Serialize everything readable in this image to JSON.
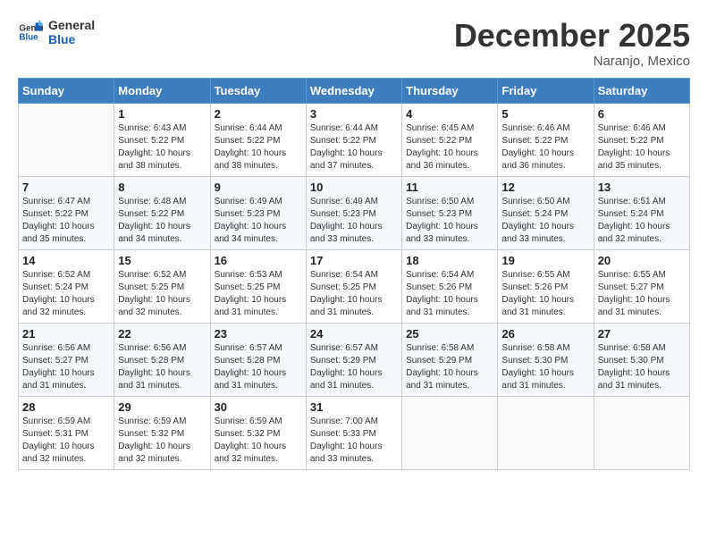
{
  "header": {
    "logo_line1": "General",
    "logo_line2": "Blue",
    "month_year": "December 2025",
    "location": "Naranjo, Mexico"
  },
  "weekdays": [
    "Sunday",
    "Monday",
    "Tuesday",
    "Wednesday",
    "Thursday",
    "Friday",
    "Saturday"
  ],
  "weeks": [
    [
      {
        "day": "",
        "info": ""
      },
      {
        "day": "1",
        "info": "Sunrise: 6:43 AM\nSunset: 5:22 PM\nDaylight: 10 hours\nand 38 minutes."
      },
      {
        "day": "2",
        "info": "Sunrise: 6:44 AM\nSunset: 5:22 PM\nDaylight: 10 hours\nand 38 minutes."
      },
      {
        "day": "3",
        "info": "Sunrise: 6:44 AM\nSunset: 5:22 PM\nDaylight: 10 hours\nand 37 minutes."
      },
      {
        "day": "4",
        "info": "Sunrise: 6:45 AM\nSunset: 5:22 PM\nDaylight: 10 hours\nand 36 minutes."
      },
      {
        "day": "5",
        "info": "Sunrise: 6:46 AM\nSunset: 5:22 PM\nDaylight: 10 hours\nand 36 minutes."
      },
      {
        "day": "6",
        "info": "Sunrise: 6:46 AM\nSunset: 5:22 PM\nDaylight: 10 hours\nand 35 minutes."
      }
    ],
    [
      {
        "day": "7",
        "info": "Sunrise: 6:47 AM\nSunset: 5:22 PM\nDaylight: 10 hours\nand 35 minutes."
      },
      {
        "day": "8",
        "info": "Sunrise: 6:48 AM\nSunset: 5:22 PM\nDaylight: 10 hours\nand 34 minutes."
      },
      {
        "day": "9",
        "info": "Sunrise: 6:49 AM\nSunset: 5:23 PM\nDaylight: 10 hours\nand 34 minutes."
      },
      {
        "day": "10",
        "info": "Sunrise: 6:49 AM\nSunset: 5:23 PM\nDaylight: 10 hours\nand 33 minutes."
      },
      {
        "day": "11",
        "info": "Sunrise: 6:50 AM\nSunset: 5:23 PM\nDaylight: 10 hours\nand 33 minutes."
      },
      {
        "day": "12",
        "info": "Sunrise: 6:50 AM\nSunset: 5:24 PM\nDaylight: 10 hours\nand 33 minutes."
      },
      {
        "day": "13",
        "info": "Sunrise: 6:51 AM\nSunset: 5:24 PM\nDaylight: 10 hours\nand 32 minutes."
      }
    ],
    [
      {
        "day": "14",
        "info": "Sunrise: 6:52 AM\nSunset: 5:24 PM\nDaylight: 10 hours\nand 32 minutes."
      },
      {
        "day": "15",
        "info": "Sunrise: 6:52 AM\nSunset: 5:25 PM\nDaylight: 10 hours\nand 32 minutes."
      },
      {
        "day": "16",
        "info": "Sunrise: 6:53 AM\nSunset: 5:25 PM\nDaylight: 10 hours\nand 31 minutes."
      },
      {
        "day": "17",
        "info": "Sunrise: 6:54 AM\nSunset: 5:25 PM\nDaylight: 10 hours\nand 31 minutes."
      },
      {
        "day": "18",
        "info": "Sunrise: 6:54 AM\nSunset: 5:26 PM\nDaylight: 10 hours\nand 31 minutes."
      },
      {
        "day": "19",
        "info": "Sunrise: 6:55 AM\nSunset: 5:26 PM\nDaylight: 10 hours\nand 31 minutes."
      },
      {
        "day": "20",
        "info": "Sunrise: 6:55 AM\nSunset: 5:27 PM\nDaylight: 10 hours\nand 31 minutes."
      }
    ],
    [
      {
        "day": "21",
        "info": "Sunrise: 6:56 AM\nSunset: 5:27 PM\nDaylight: 10 hours\nand 31 minutes."
      },
      {
        "day": "22",
        "info": "Sunrise: 6:56 AM\nSunset: 5:28 PM\nDaylight: 10 hours\nand 31 minutes."
      },
      {
        "day": "23",
        "info": "Sunrise: 6:57 AM\nSunset: 5:28 PM\nDaylight: 10 hours\nand 31 minutes."
      },
      {
        "day": "24",
        "info": "Sunrise: 6:57 AM\nSunset: 5:29 PM\nDaylight: 10 hours\nand 31 minutes."
      },
      {
        "day": "25",
        "info": "Sunrise: 6:58 AM\nSunset: 5:29 PM\nDaylight: 10 hours\nand 31 minutes."
      },
      {
        "day": "26",
        "info": "Sunrise: 6:58 AM\nSunset: 5:30 PM\nDaylight: 10 hours\nand 31 minutes."
      },
      {
        "day": "27",
        "info": "Sunrise: 6:58 AM\nSunset: 5:30 PM\nDaylight: 10 hours\nand 31 minutes."
      }
    ],
    [
      {
        "day": "28",
        "info": "Sunrise: 6:59 AM\nSunset: 5:31 PM\nDaylight: 10 hours\nand 32 minutes."
      },
      {
        "day": "29",
        "info": "Sunrise: 6:59 AM\nSunset: 5:32 PM\nDaylight: 10 hours\nand 32 minutes."
      },
      {
        "day": "30",
        "info": "Sunrise: 6:59 AM\nSunset: 5:32 PM\nDaylight: 10 hours\nand 32 minutes."
      },
      {
        "day": "31",
        "info": "Sunrise: 7:00 AM\nSunset: 5:33 PM\nDaylight: 10 hours\nand 33 minutes."
      },
      {
        "day": "",
        "info": ""
      },
      {
        "day": "",
        "info": ""
      },
      {
        "day": "",
        "info": ""
      }
    ]
  ]
}
